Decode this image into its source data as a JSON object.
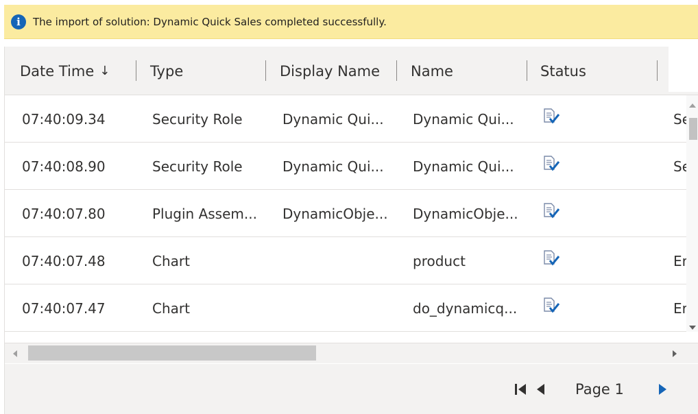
{
  "notification": {
    "icon": "info-icon",
    "message": "The import of solution: Dynamic Quick Sales completed successfully."
  },
  "grid": {
    "columns": [
      {
        "label": "Date Time",
        "sort_indicator": "↓"
      },
      {
        "label": "Type"
      },
      {
        "label": "Display Name"
      },
      {
        "label": "Name"
      },
      {
        "label": "Status"
      }
    ],
    "rows": [
      {
        "datetime": "07:40:09.34",
        "type": "Security Role",
        "display_name": "Dynamic Qui...",
        "name": "Dynamic Qui...",
        "status_icon": "document-check-icon",
        "overflow": "Se"
      },
      {
        "datetime": "07:40:08.90",
        "type": "Security Role",
        "display_name": "Dynamic Qui...",
        "name": "Dynamic Qui...",
        "status_icon": "document-check-icon",
        "overflow": "Se"
      },
      {
        "datetime": "07:40:07.80",
        "type": "Plugin Assem...",
        "display_name": "DynamicObje...",
        "name": "DynamicObje...",
        "status_icon": "document-check-icon",
        "overflow": ""
      },
      {
        "datetime": "07:40:07.48",
        "type": "Chart",
        "display_name": "",
        "name": "product",
        "status_icon": "document-check-icon",
        "overflow": "Er"
      },
      {
        "datetime": "07:40:07.47",
        "type": "Chart",
        "display_name": "",
        "name": "do_dynamicq...",
        "status_icon": "document-check-icon",
        "overflow": "Er"
      }
    ]
  },
  "pager": {
    "label": "Page 1",
    "first_icon": "first-page-icon",
    "prev_icon": "previous-page-icon",
    "next_icon": "next-page-icon"
  },
  "colors": {
    "notification_bg": "#fbeba0",
    "info_icon": "#1565b7",
    "header_bg": "#f3f2f1",
    "pager_next": "#1565b7"
  }
}
